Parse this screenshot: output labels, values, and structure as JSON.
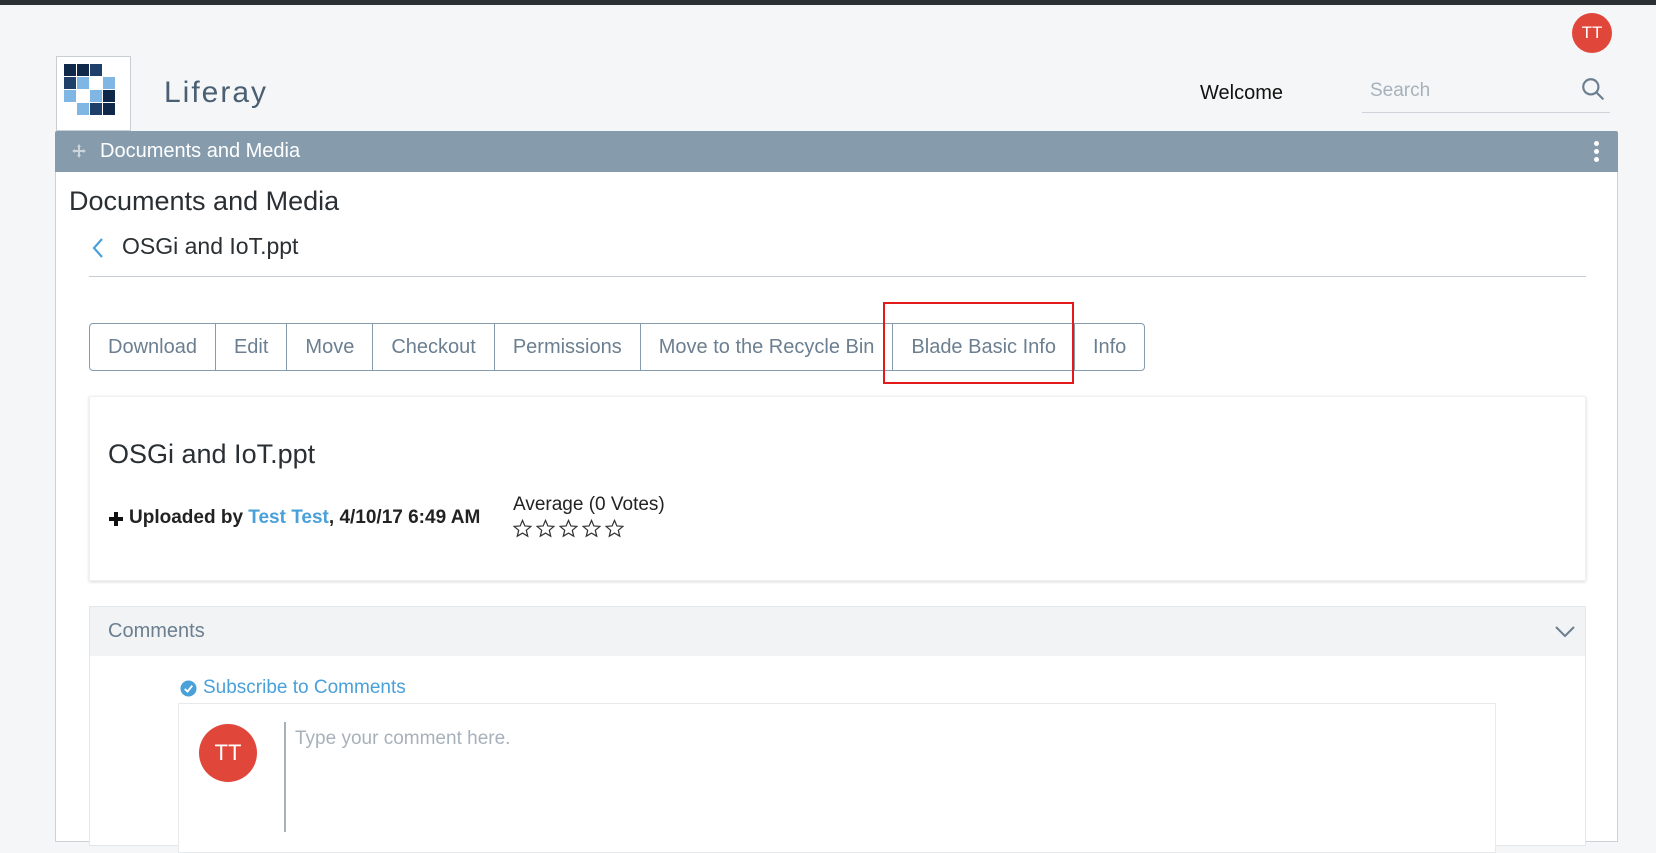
{
  "header": {
    "user_initials": "TT",
    "site_name": "Liferay",
    "welcome": "Welcome",
    "search_placeholder": "Search"
  },
  "portlet": {
    "bar_title": "Documents and Media",
    "title": "Documents and Media",
    "file_name": "OSGi and IoT.ppt"
  },
  "actions": [
    "Download",
    "Edit",
    "Move",
    "Checkout",
    "Permissions",
    "Move to the Recycle Bin",
    "Blade Basic Info",
    "Info"
  ],
  "file_card": {
    "title": "OSGi and IoT.ppt",
    "uploaded_prefix": "Uploaded by ",
    "uploader": "Test Test",
    "uploaded_suffix": ", 4/10/17 6:49 AM",
    "rating_label": "Average (0 Votes)",
    "stars_filled": 0,
    "stars_total": 5
  },
  "comments": {
    "title": "Comments",
    "subscribe": "Subscribe to Comments",
    "avatar_initials": "TT",
    "placeholder": "Type your comment here."
  },
  "colors": {
    "accent": "#4aa0d9",
    "portlet_bar": "#869cad",
    "avatar": "#e0463a",
    "highlight": "#e21a1a"
  }
}
